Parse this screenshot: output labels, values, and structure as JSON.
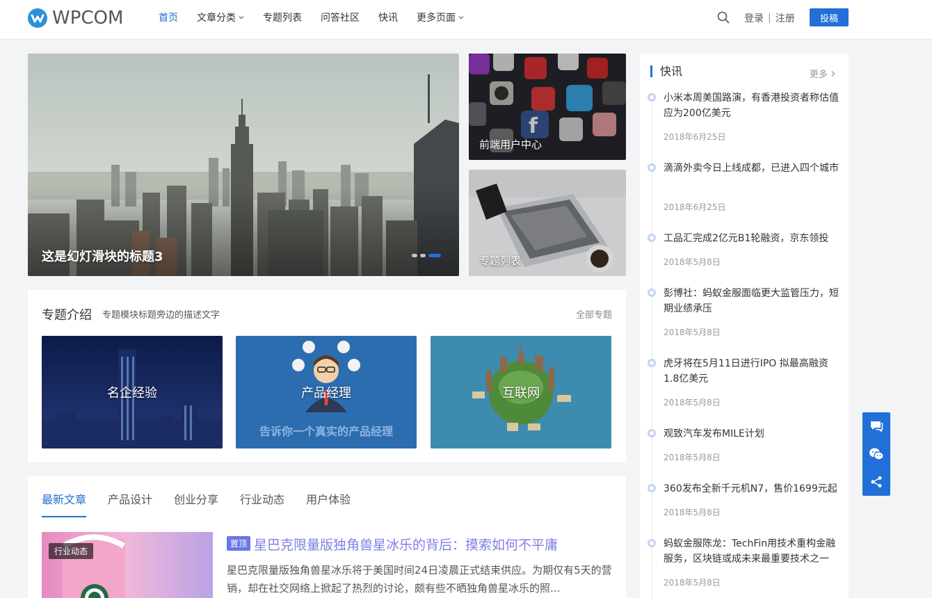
{
  "brand": {
    "name": "WPCOM",
    "accent": "#2070d8"
  },
  "nav": {
    "items": [
      {
        "label": "首页",
        "active": true,
        "dropdown": false
      },
      {
        "label": "文章分类",
        "active": false,
        "dropdown": true
      },
      {
        "label": "专题列表",
        "active": false,
        "dropdown": false
      },
      {
        "label": "问答社区",
        "active": false,
        "dropdown": false
      },
      {
        "label": "快讯",
        "active": false,
        "dropdown": false
      },
      {
        "label": "更多页面",
        "active": false,
        "dropdown": true
      }
    ],
    "login": "登录",
    "separator": "|",
    "register": "注册",
    "submit": "投稿"
  },
  "slider": {
    "title": "这是幻灯滑块的标题3",
    "slide_count": 3,
    "active_index": 3
  },
  "side_cards": [
    {
      "label": "前端用户中心"
    },
    {
      "label": "专题列表"
    }
  ],
  "topics": {
    "title": "专题介绍",
    "desc": "专题模块标题旁边的描述文字",
    "more": "全部专题",
    "cards": [
      {
        "label": "名企经验"
      },
      {
        "label": "产品经理",
        "caption": "告诉你一个真实的产品经理"
      },
      {
        "label": "互联网"
      }
    ]
  },
  "articles": {
    "tabs": [
      {
        "label": "最新文章",
        "active": true
      },
      {
        "label": "产品设计",
        "active": false
      },
      {
        "label": "创业分享",
        "active": false
      },
      {
        "label": "行业动态",
        "active": false
      },
      {
        "label": "用户体验",
        "active": false
      }
    ],
    "first": {
      "category": "行业动态",
      "sticky": "置顶",
      "title": "星巴克限量版独角兽星冰乐的背后：摸索如何不平庸",
      "excerpt": "星巴克限量版独角兽星冰乐将于美国时间24日凌晨正式结束供应。为期仅有5天的营销，却在社交网络上掀起了热烈的讨论，颇有些不晒独角兽星冰乐的照..."
    }
  },
  "news": {
    "title": "快讯",
    "more": "更多",
    "items": [
      {
        "title": "小米本周美国路演，有香港投资者称估值应为200亿美元",
        "date": "2018年6月25日"
      },
      {
        "title": "滴滴外卖今日上线成都，已进入四个城市",
        "date": "2018年6月25日"
      },
      {
        "title": "工品汇完成2亿元B1轮融资，京东领投",
        "date": "2018年5月8日"
      },
      {
        "title": "彭博社：蚂蚁金服面临更大监管压力，短期业绩承压",
        "date": "2018年5月8日"
      },
      {
        "title": "虎牙将在5月11日进行IPO 拟最高融资1.8亿美元",
        "date": "2018年5月8日"
      },
      {
        "title": "观致汽车发布MILE计划",
        "date": "2018年5月8日"
      },
      {
        "title": "360发布全新千元机N7，售价1699元起",
        "date": "2018年5月8日"
      },
      {
        "title": "蚂蚁金服陈龙：TechFin用技术重构金融服务，区块链或成未来最重要技术之一",
        "date": "2018年5月8日"
      }
    ]
  },
  "float_bar": {
    "buttons": [
      "chat-icon",
      "wechat-icon",
      "share-icon"
    ]
  }
}
